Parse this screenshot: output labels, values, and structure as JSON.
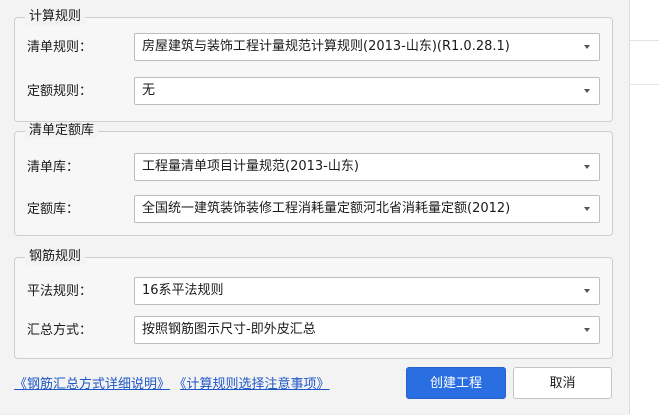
{
  "groups": {
    "calc_rules": {
      "title": "计算规则",
      "rows": [
        {
          "label": "清单规则：",
          "value": "房屋建筑与装饰工程计量规范计算规则(2013-山东)(R1.0.28.1)"
        },
        {
          "label": "定额规则：",
          "value": "无"
        }
      ]
    },
    "quota_lib": {
      "title": "清单定额库",
      "rows": [
        {
          "label": "清单库：",
          "value": "工程量清单项目计量规范(2013-山东)"
        },
        {
          "label": "定额库：",
          "value": "全国统一建筑装饰装修工程消耗量定额河北省消耗量定额(2012)"
        }
      ]
    },
    "rebar_rules": {
      "title": "钢筋规则",
      "rows": [
        {
          "label": "平法规则：",
          "value": "16系平法规则"
        },
        {
          "label": "汇总方式：",
          "value": "按照钢筋图示尺寸-即外皮汇总"
        }
      ]
    }
  },
  "links": {
    "rebar_summary": "《钢筋汇总方式详细说明》",
    "calc_rule_notes": "《计算规则选择注意事项》"
  },
  "buttons": {
    "create": "创建工程",
    "cancel": "取消"
  },
  "colors": {
    "primary": "#2a6fe2",
    "link": "#1f57c7"
  }
}
